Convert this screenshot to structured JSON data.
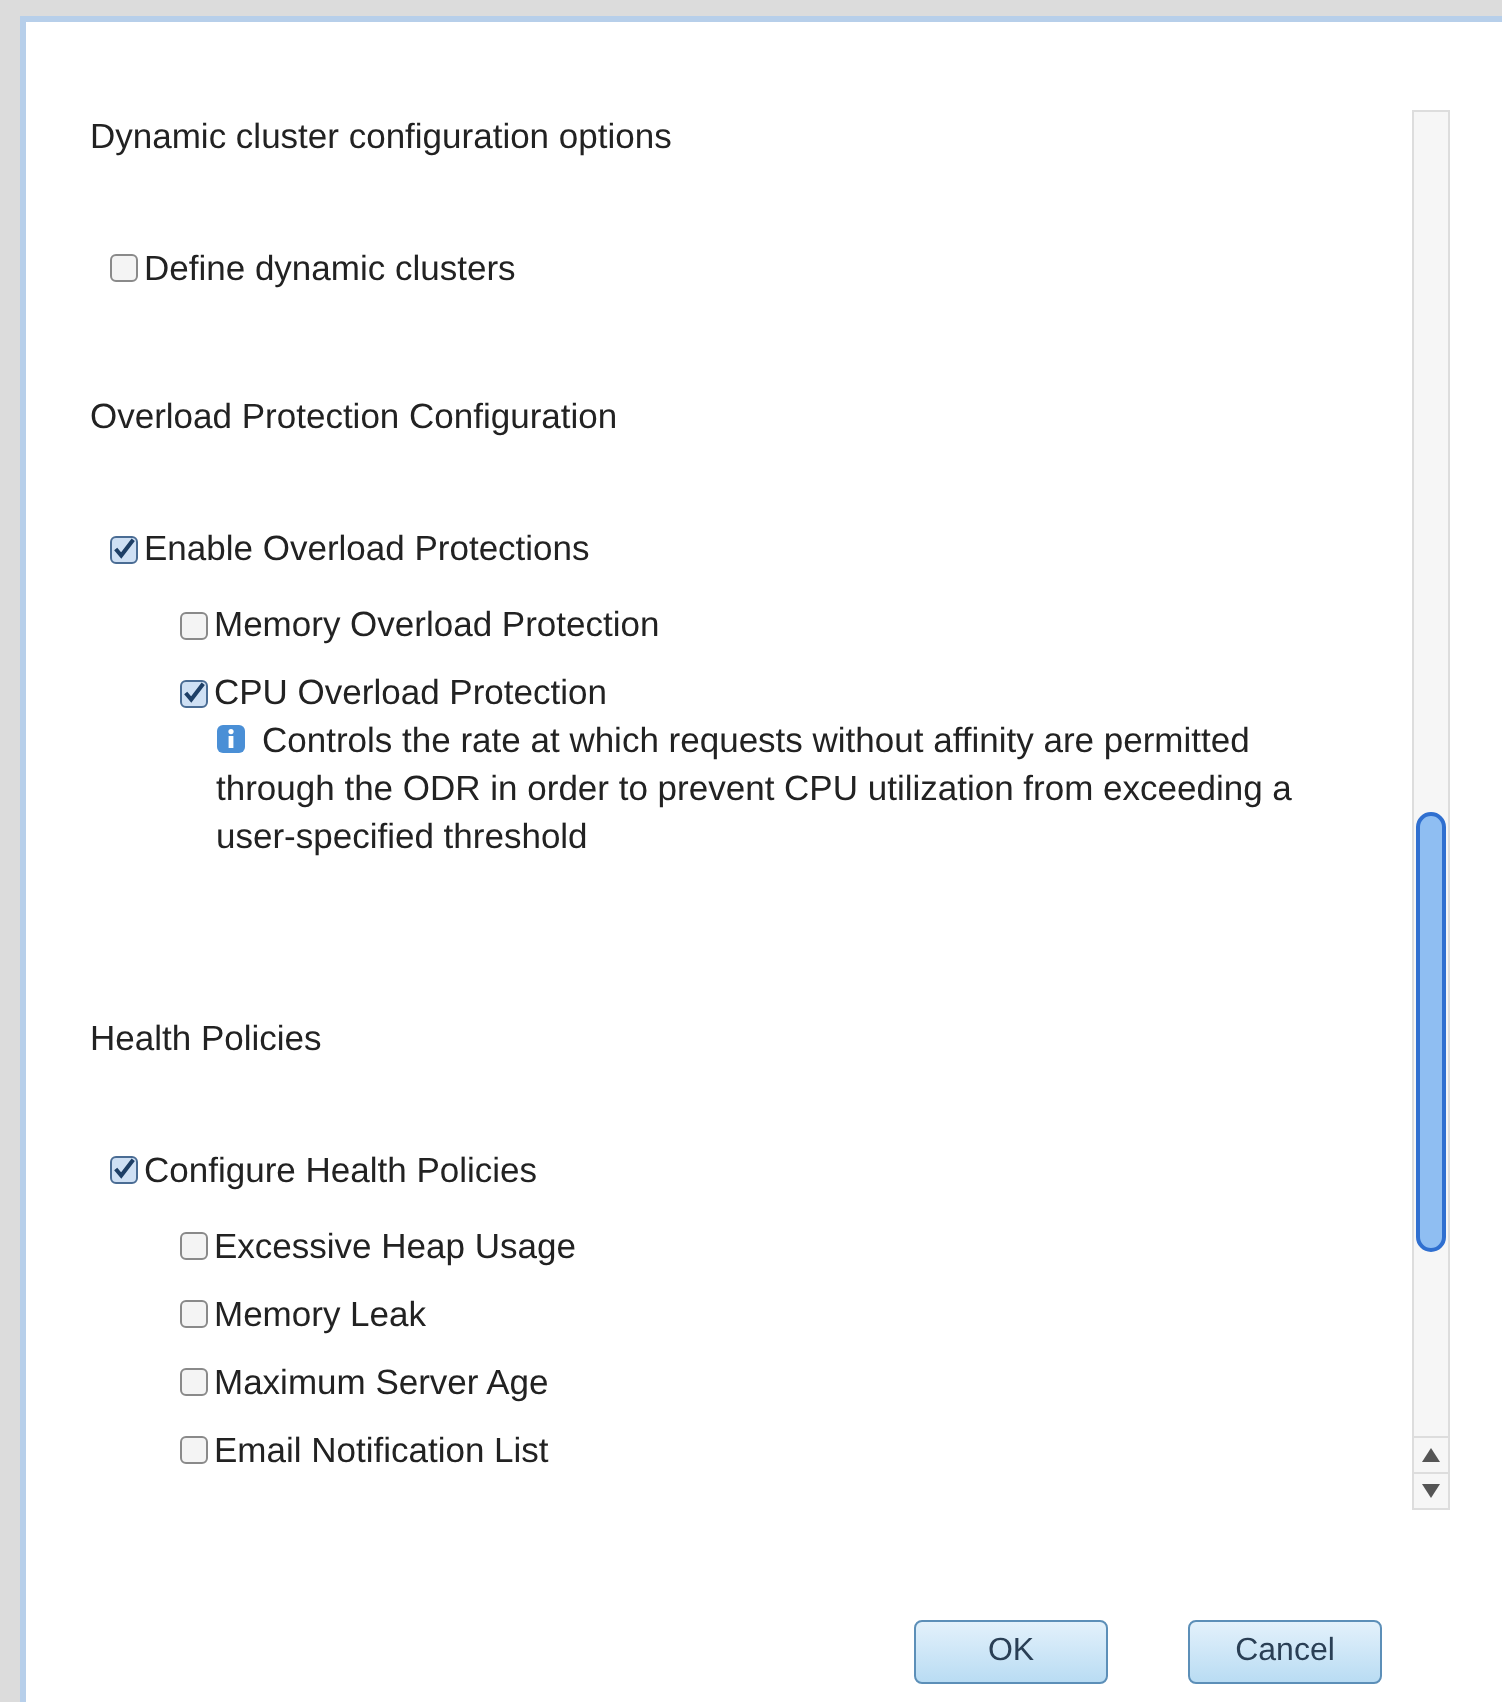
{
  "sections": [
    {
      "heading": "Dynamic cluster configuration options",
      "items": [
        {
          "label": "Define dynamic clusters",
          "checked": false
        }
      ]
    },
    {
      "heading": "Overload Protection Configuration",
      "items": [
        {
          "label": "Enable Overload Protections",
          "checked": true,
          "children": [
            {
              "label": "Memory Overload Protection",
              "checked": false
            },
            {
              "label": "CPU Overload Protection",
              "checked": true,
              "info": "Controls the rate at which requests without affinity are permitted through the ODR in order to prevent CPU utilization from exceeding a user-specified threshold"
            }
          ]
        }
      ]
    },
    {
      "heading": "Health Policies",
      "items": [
        {
          "label": "Configure Health Policies",
          "checked": true,
          "children": [
            {
              "label": "Excessive Heap Usage",
              "checked": false
            },
            {
              "label": "Memory Leak",
              "checked": false
            },
            {
              "label": "Maximum Server Age",
              "checked": false
            },
            {
              "label": "Email Notification List",
              "checked": false
            }
          ]
        }
      ]
    }
  ],
  "buttons": [
    "OK",
    "Cancel"
  ]
}
